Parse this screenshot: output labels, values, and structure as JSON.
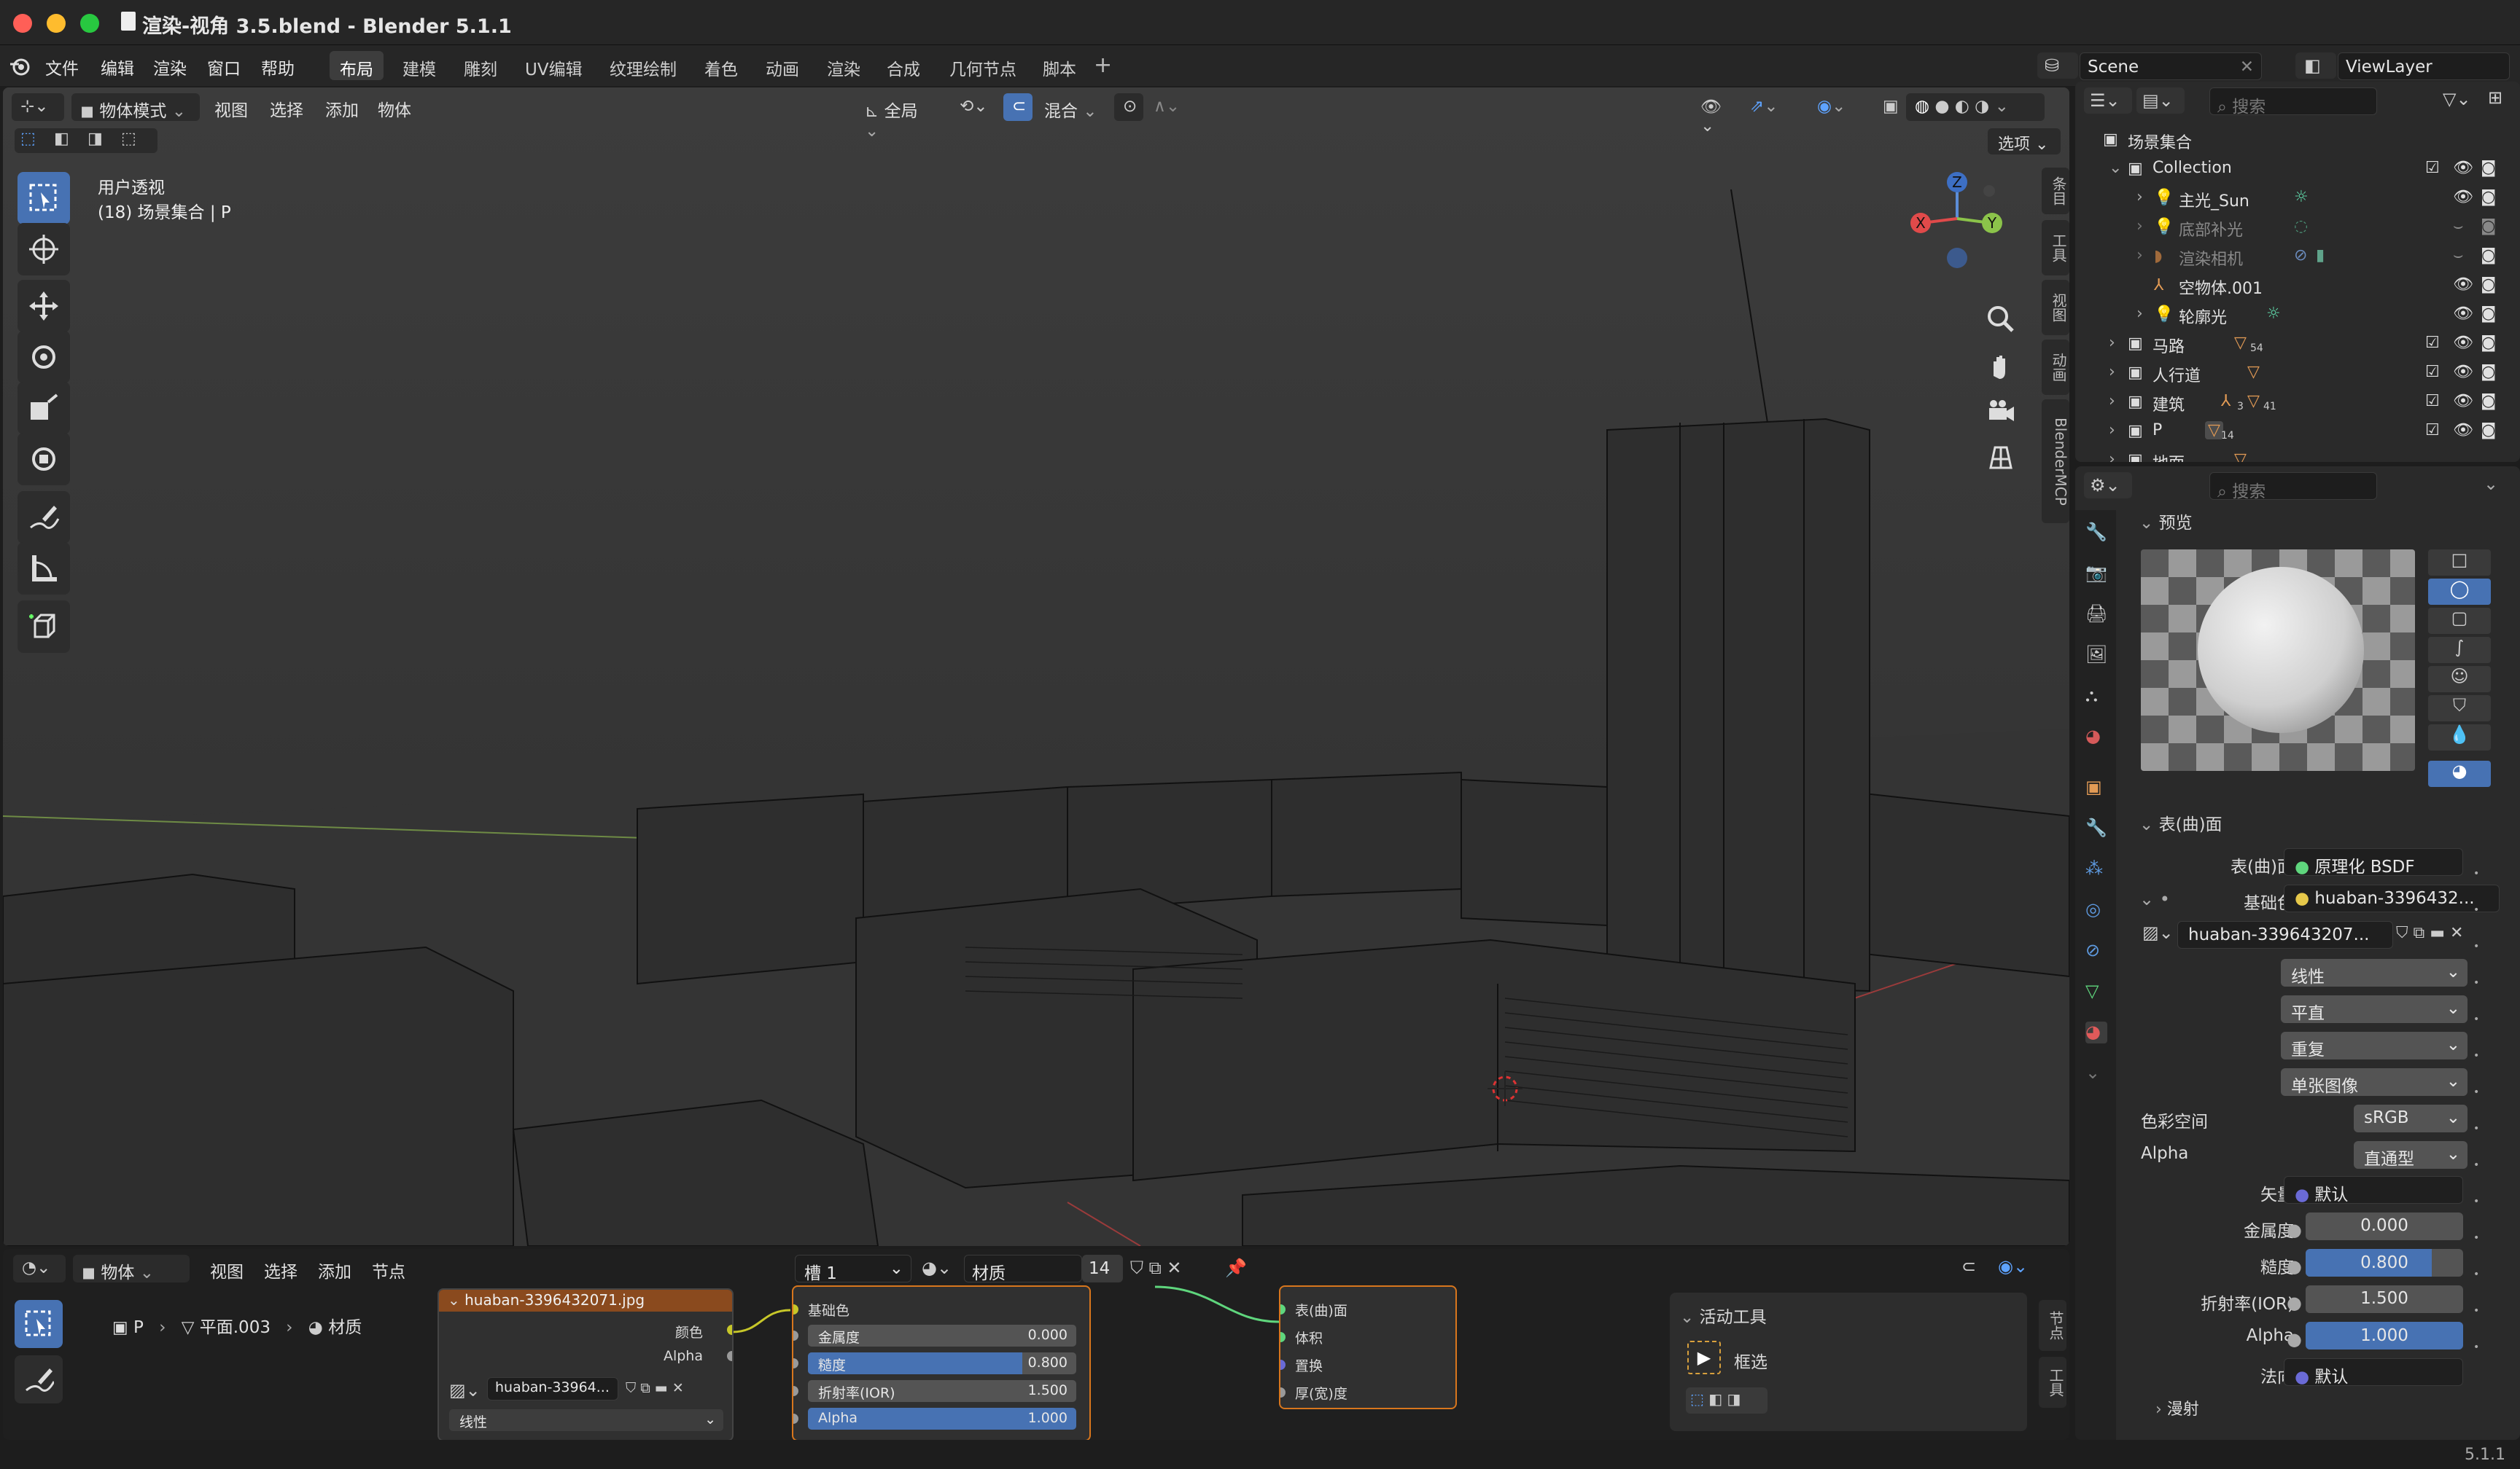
{
  "window": {
    "title": "渲染-视角 3.5.blend - Blender 5.1.1"
  },
  "menu": {
    "items": [
      "文件",
      "编辑",
      "渲染",
      "窗口",
      "帮助"
    ],
    "workspaces": [
      "布局",
      "建模",
      "雕刻",
      "UV编辑",
      "纹理绘制",
      "着色",
      "动画",
      "渲染",
      "合成",
      "几何节点",
      "脚本"
    ],
    "active_workspace": "布局",
    "scene": "Scene",
    "view_layer": "ViewLayer"
  },
  "viewport": {
    "mode": "物体模式",
    "menus": [
      "视图",
      "选择",
      "添加",
      "物体"
    ],
    "transform_orientation": "全局",
    "snap_target": "混合",
    "options_label": "选项",
    "overlay_title": "用户透视",
    "overlay_subtitle": "(18) 场景集合 | P",
    "side_tabs": [
      "条目",
      "工具",
      "视图",
      "动画",
      "BlenderMCP"
    ],
    "gizmo": {
      "x": "X",
      "y": "Y",
      "z": "Z"
    }
  },
  "outliner": {
    "search_placeholder": "搜索",
    "root": "场景集合",
    "rows": [
      {
        "label": "Collection",
        "level": 1
      },
      {
        "label": "主光_Sun",
        "level": 2
      },
      {
        "label": "底部补光",
        "level": 2
      },
      {
        "label": "渲染相机",
        "level": 2
      },
      {
        "label": "空物体.001",
        "level": 2
      },
      {
        "label": "轮廓光",
        "level": 2
      },
      {
        "label": "马路",
        "level": 1,
        "badge": "54"
      },
      {
        "label": "人行道",
        "level": 1
      },
      {
        "label": "建筑",
        "level": 1,
        "badge": "3",
        "badge2": "41"
      },
      {
        "label": "P",
        "level": 1,
        "badge": "14"
      },
      {
        "label": "地面",
        "level": 1
      }
    ]
  },
  "properties": {
    "search_placeholder": "搜索",
    "preview_label": "预览",
    "surface_panel": "表(曲)面",
    "surface_label": "表(曲)面",
    "surface_value": "原理化 BSDF",
    "base_color_label": "基础色",
    "base_color_value": "huaban-3396432...",
    "image_name": "huaban-339643207...",
    "interpolation": "线性",
    "projection": "平直",
    "extension": "重复",
    "source": "单张图像",
    "color_space_label": "色彩空间",
    "color_space_value": "sRGB",
    "alpha_label": "Alpha",
    "alpha_mode": "直通型",
    "vector_label": "矢量",
    "vector_value": "默认",
    "metallic_label": "金属度",
    "metallic_value": "0.000",
    "metallic_fill": 0,
    "roughness_label": "糙度",
    "roughness_value": "0.800",
    "roughness_fill": 0.8,
    "ior_label": "折射率(IOR)",
    "ior_value": "1.500",
    "alpha2_label": "Alpha",
    "alpha2_value": "1.000",
    "alpha2_fill": 1.0,
    "normal_label": "法向",
    "normal_value": "默认",
    "subsurface_label": "漫射"
  },
  "node_editor": {
    "editor_type": "物体",
    "menus": [
      "视图",
      "选择",
      "添加",
      "节点"
    ],
    "slot": "槽 1",
    "material": "材质",
    "user_count": "14",
    "breadcrumb": [
      "P",
      "平面.003",
      "材质"
    ],
    "image_node": {
      "title": "huaban-3396432071.jpg",
      "outputs": [
        "颜色",
        "Alpha"
      ],
      "image": "huaban-33964...",
      "interpolation": "线性"
    },
    "bsdf_node": {
      "base_color": "基础色",
      "metallic_label": "金属度",
      "metallic_value": "0.000",
      "roughness_label": "糙度",
      "roughness_value": "0.800",
      "ior_label": "折射率(IOR)",
      "ior_value": "1.500",
      "alpha_label": "Alpha",
      "alpha_value": "1.000"
    },
    "output_node": {
      "inputs": [
        "表(曲)面",
        "体积",
        "置换",
        "厚(宽)度"
      ]
    },
    "active_tool": {
      "title": "活动工具",
      "tool": "框选"
    },
    "side_tabs": [
      "节点",
      "工具"
    ]
  },
  "status": {
    "version": "5.1.1"
  },
  "colors": {
    "accent_blue": "#4772b3",
    "node_image_header": "#8a4a1e",
    "active_tool": "#4772b3"
  }
}
